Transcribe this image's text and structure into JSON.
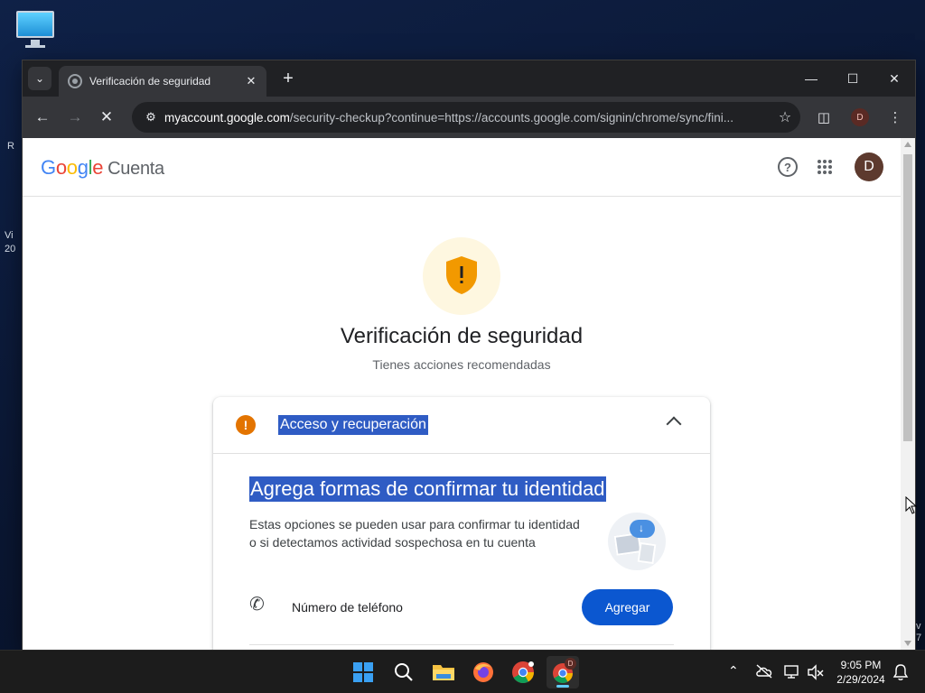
{
  "desktop": {
    "side_text_1": "R",
    "side_text_2": "Vi",
    "side_text_3": "20",
    "side_text_4": "v",
    "side_text_5": "7"
  },
  "browser": {
    "tab_title": "Verificación de seguridad",
    "url_host": "myaccount.google.com",
    "url_rest": "/security-checkup?continue=https://accounts.google.com/signin/chrome/sync/fini...",
    "profile_initial": "D"
  },
  "page": {
    "logo_letters": [
      "G",
      "o",
      "o",
      "g",
      "l",
      "e"
    ],
    "product_name": "Cuenta",
    "avatar_initial": "D",
    "title": "Verificación de seguridad",
    "subtitle": "Tienes acciones recomendadas",
    "card": {
      "header_title": "Acceso y recuperación",
      "section_title": "Agrega formas de confirmar tu identidad",
      "section_desc": "Estas opciones se pueden usar para confirmar tu identidad o si detectamos actividad sospechosa en tu cuenta",
      "phone_label": "Número de teléfono",
      "add_button": "Agregar"
    }
  },
  "taskbar": {
    "time": "9:05 PM",
    "date": "2/29/2024",
    "chrome_profile_badge": "D"
  },
  "colors": {
    "accent_blue": "#0b57d0",
    "warning_orange": "#e37400",
    "selection_blue": "#2f5cc4"
  }
}
